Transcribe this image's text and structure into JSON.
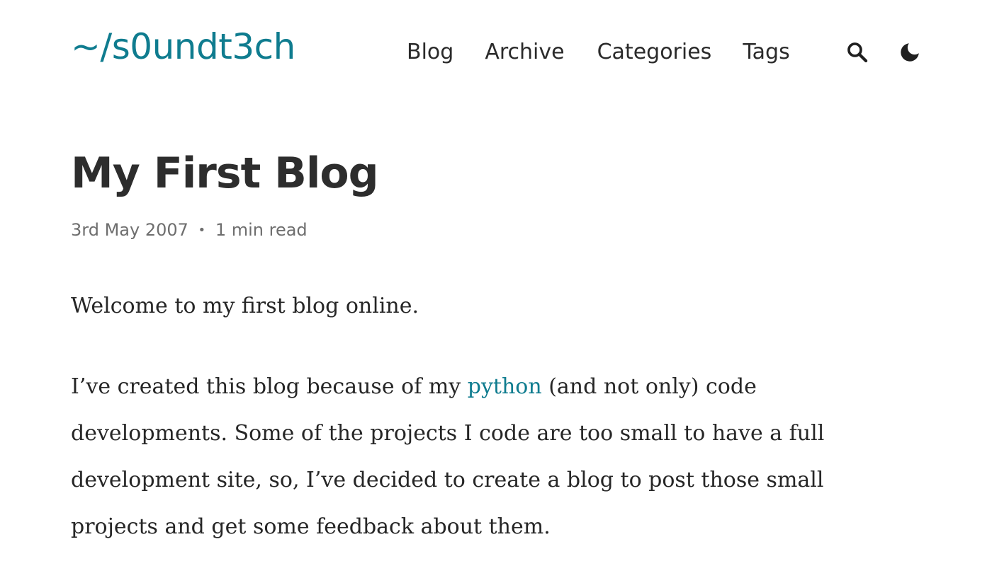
{
  "header": {
    "site_title": "~/s0undt3ch",
    "nav": {
      "blog": "Blog",
      "archive": "Archive",
      "categories": "Categories",
      "tags": "Tags"
    },
    "icons": {
      "search": "search-icon",
      "theme": "moon-icon"
    }
  },
  "post": {
    "title": "My First Blog",
    "meta": {
      "date": "3rd May 2007",
      "separator": "•",
      "read_time": "1 min read"
    },
    "paragraph1": "Welcome to my first blog online.",
    "paragraph2": {
      "before_link": "I’ve created this blog because of my ",
      "link_text": "python",
      "after_link": " (and not only) code developments. Some of the projects I code are too small to have a full development site, so, I’ve decided to create a blog to post those small projects and get some feedback about them."
    }
  },
  "colors": {
    "accent": "#0f7c8f",
    "text": "#262626",
    "meta": "#6e6e6e"
  }
}
